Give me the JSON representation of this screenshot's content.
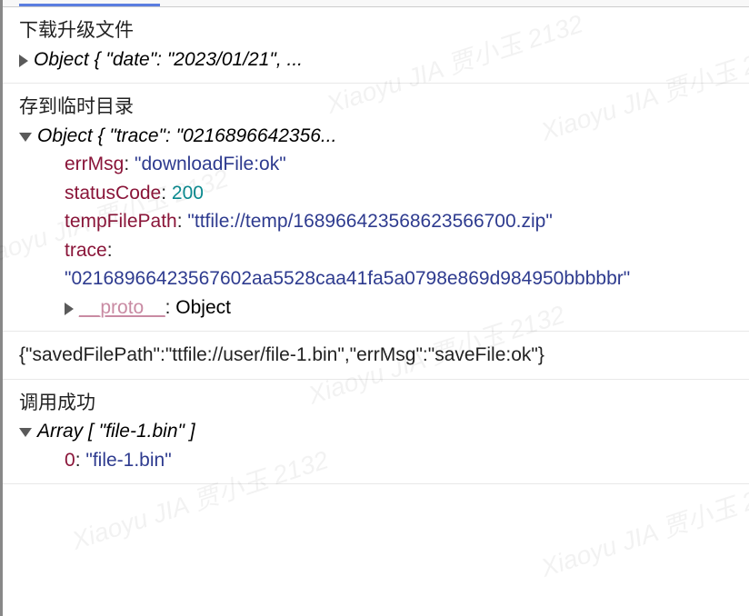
{
  "watermark": "Xiaoyu JIA 贾小玉 2132",
  "groups": [
    {
      "label": "下载升级文件",
      "summary": "Object { \"date\": \"2023/01/21\", ..."
    },
    {
      "label": "存到临时目录",
      "summary": "Object { \"trace\": \"0216896642356...",
      "props": {
        "errMsg": {
          "value": "\"downloadFile:ok\"",
          "type": "str"
        },
        "statusCode": {
          "value": "200",
          "type": "num"
        },
        "tempFilePath": {
          "value": "\"ttfile://temp/168966423568623566700.zip\"",
          "type": "str"
        },
        "trace": {
          "value": "\"02168966423567602aa5528caa41fa5a0798e869d984950bbbbbr\"",
          "type": "str"
        }
      },
      "proto_label": "__proto__",
      "proto_value": "Object"
    },
    {
      "raw": "{\"savedFilePath\":\"ttfile://user/file-1.bin\",\"errMsg\":\"saveFile:ok\"}"
    },
    {
      "label": "调用成功",
      "summary": "Array [ \"file-1.bin\" ]",
      "array": [
        {
          "index": "0",
          "value": "\"file-1.bin\""
        }
      ]
    }
  ]
}
